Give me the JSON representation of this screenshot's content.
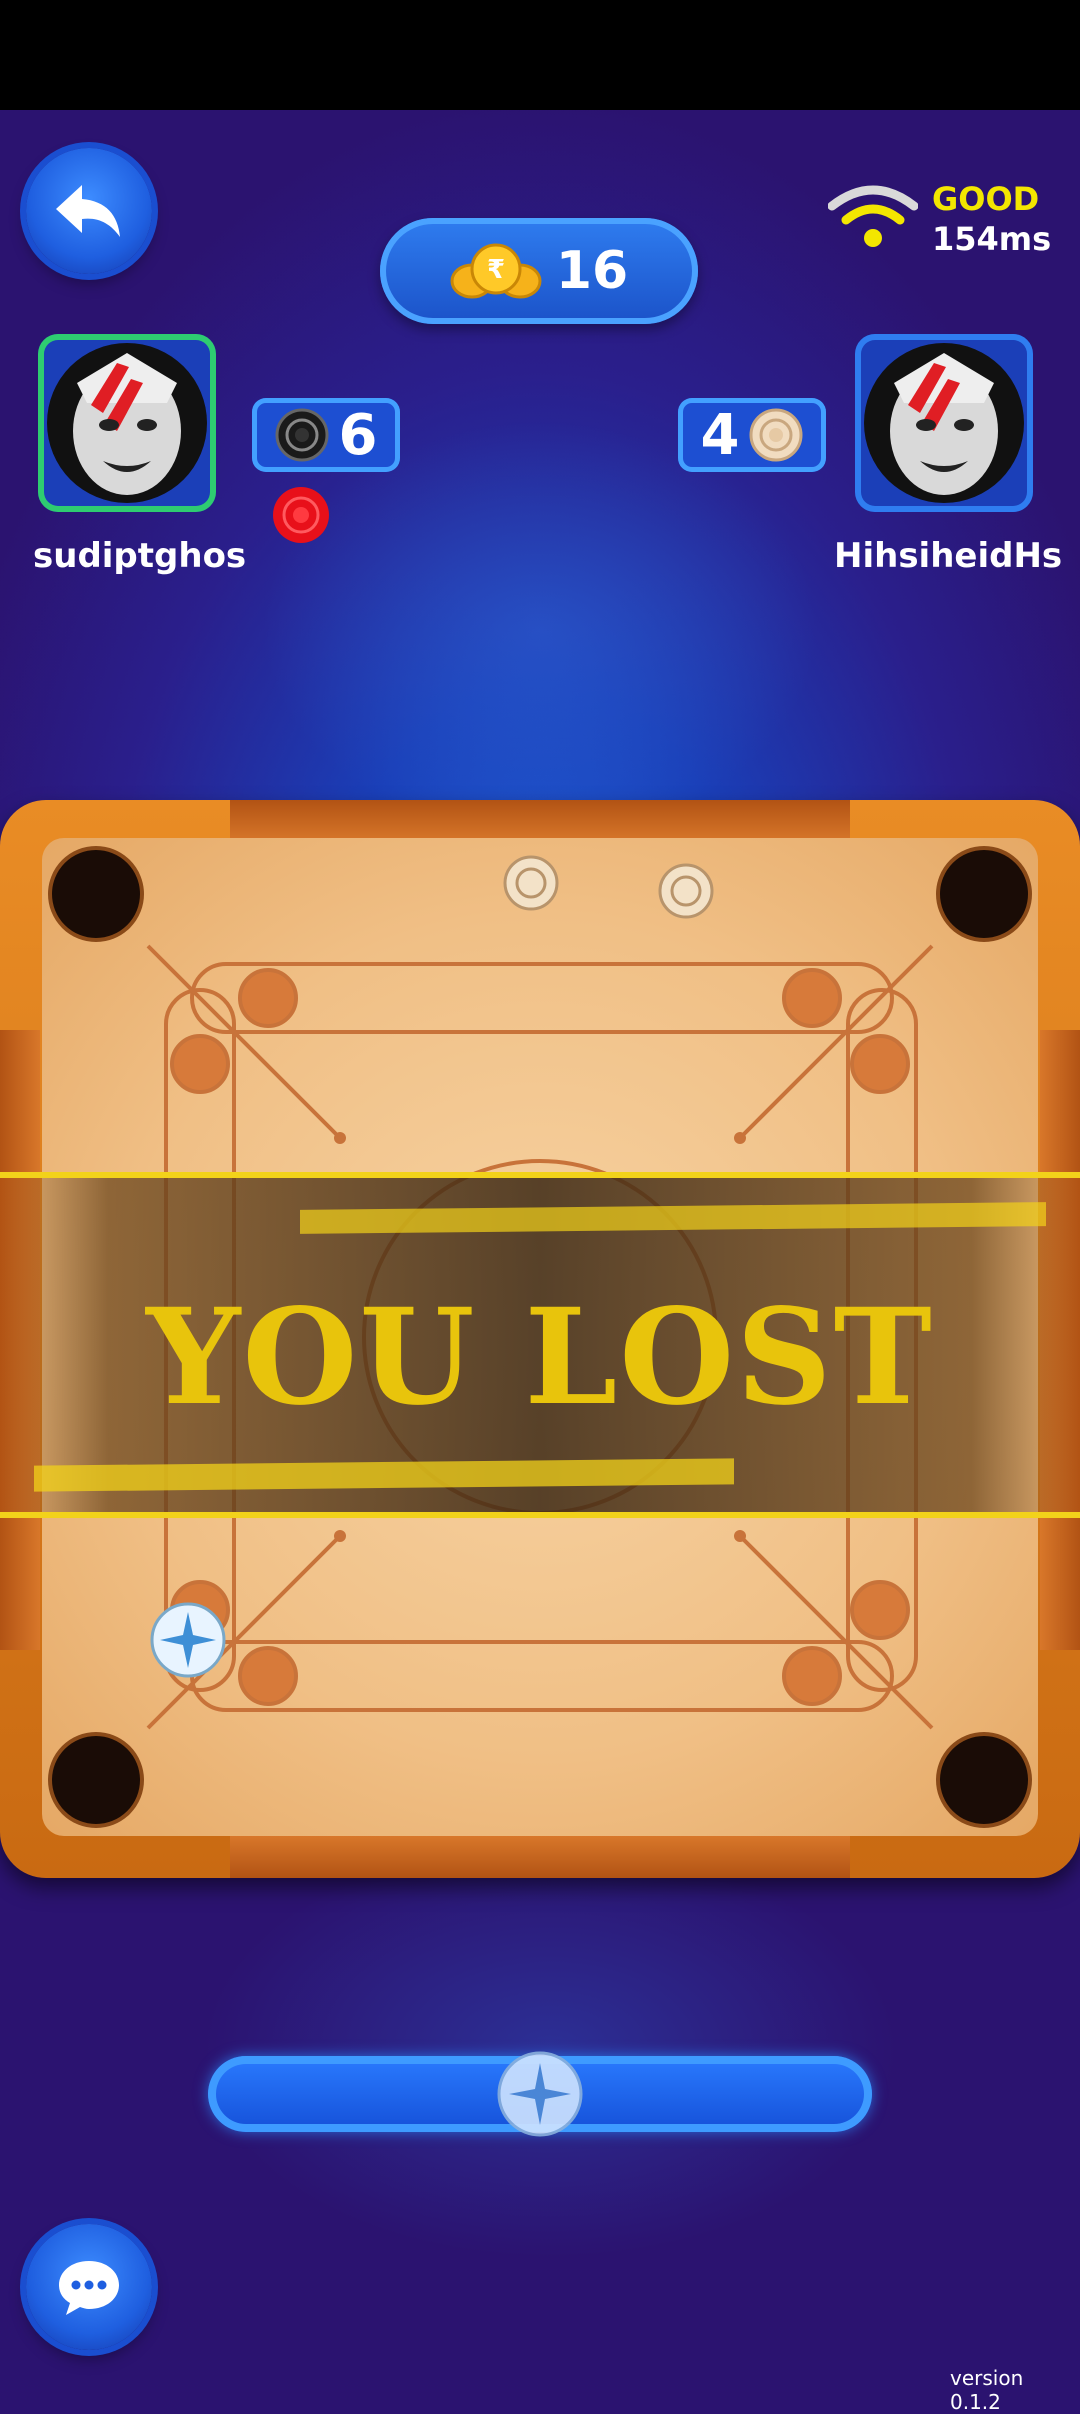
{
  "game": {
    "coins": "16",
    "network": {
      "quality": "GOOD",
      "latency": "154ms"
    },
    "players": {
      "left": {
        "name": "sudiptghos",
        "score": "6",
        "piece_color": "black"
      },
      "right": {
        "name": "HihsiheidHs",
        "score": "4",
        "piece_color": "white"
      }
    },
    "result_text": "YOU LOST",
    "version": "version 0.1.2"
  },
  "icons": {
    "back": "back-arrow-icon",
    "coin": "rupee-coins-icon",
    "wifi": "wifi-icon",
    "chat": "chat-bubble-icon",
    "striker": "striker-icon"
  },
  "colors": {
    "accent_blue": "#1f5fe0",
    "result_yellow": "#e8c40c",
    "network_good": "#f3e600",
    "turn_indicator": "#e8101a"
  }
}
